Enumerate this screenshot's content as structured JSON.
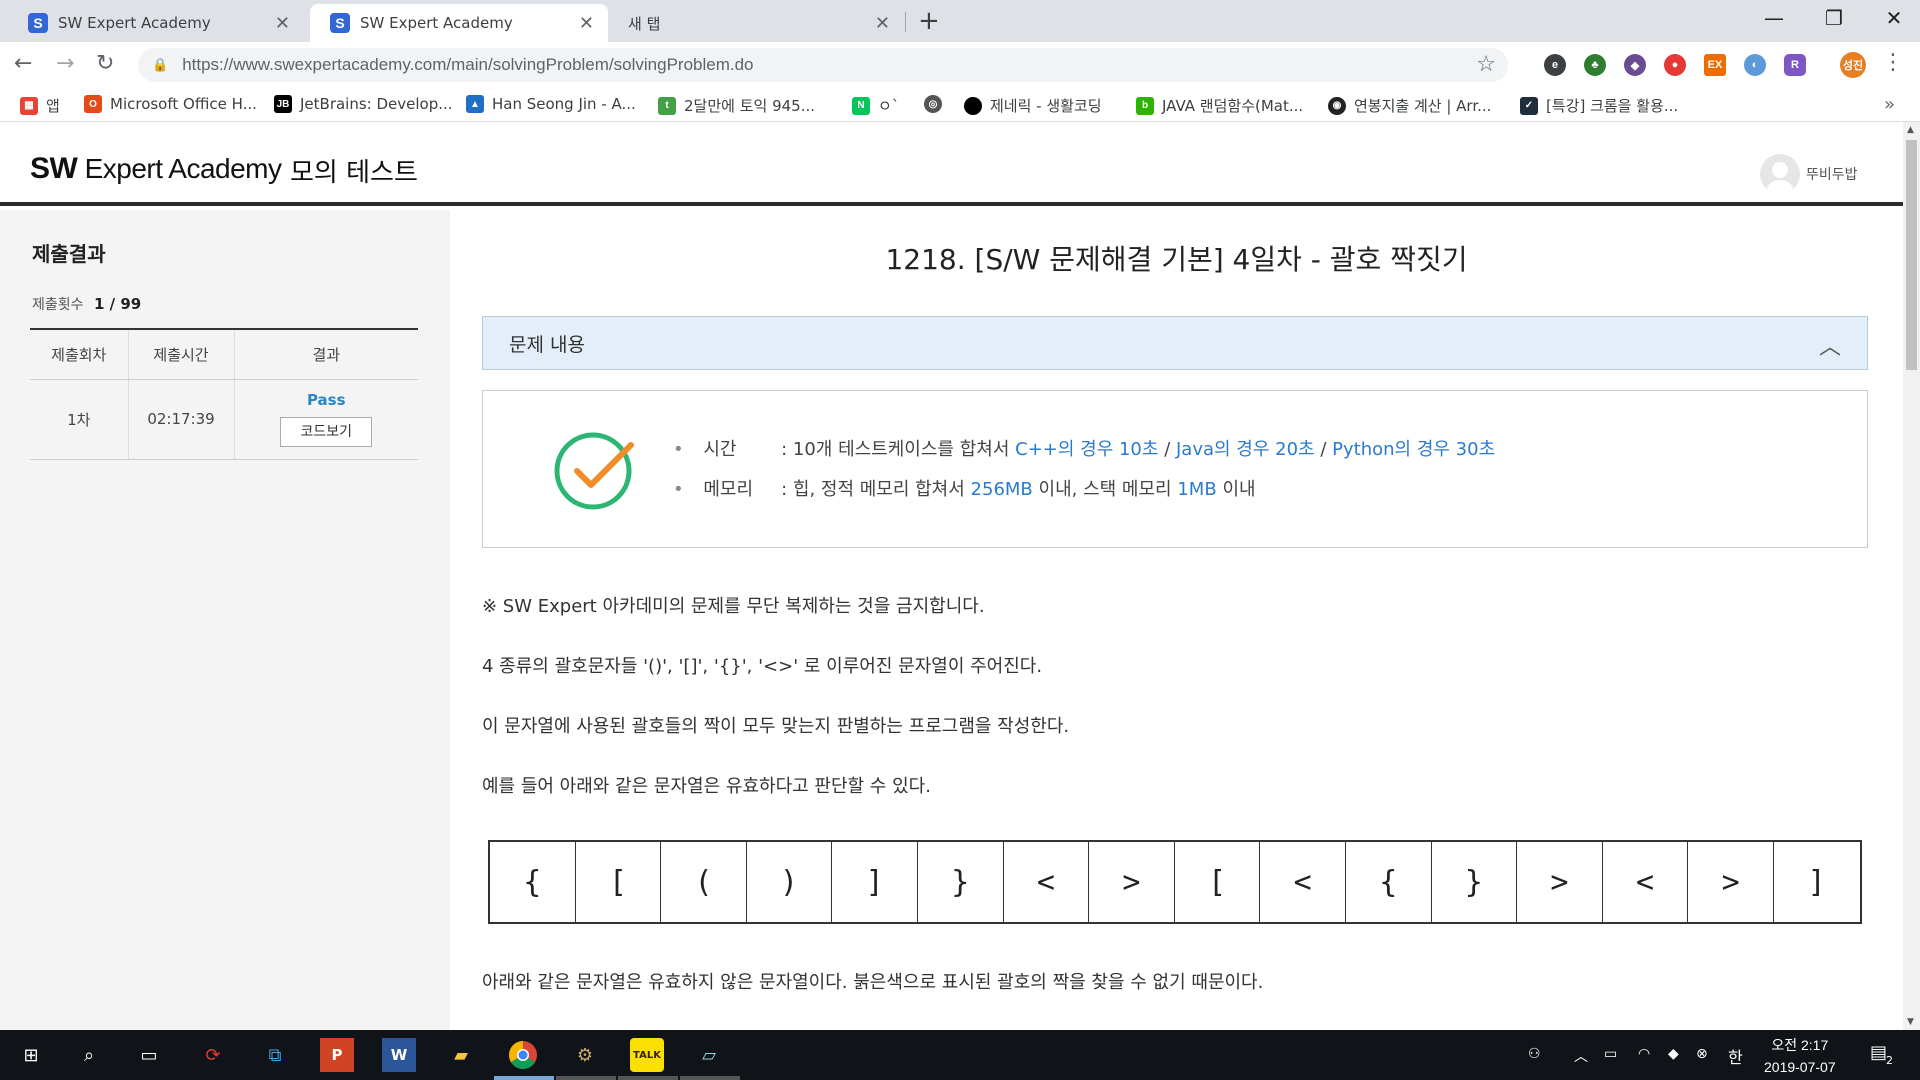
{
  "browser": {
    "tabs": [
      {
        "title": "SW Expert Academy",
        "favicon": "S",
        "active": false
      },
      {
        "title": "SW Expert Academy",
        "favicon": "S",
        "active": true
      },
      {
        "title": "새 탭",
        "favicon": "",
        "active": false
      }
    ],
    "url": "https://www.swexpertacademy.com/main/solvingProblem/solvingProblem.do",
    "profile_badge": "성진",
    "bookmarks": [
      {
        "label": "앱",
        "color": "#e94235"
      },
      {
        "label": "Microsoft Office H...",
        "color": "#e64a19"
      },
      {
        "label": "JetBrains: Develop...",
        "color": "#000000"
      },
      {
        "label": "Han Seong Jin - A...",
        "color": "#1e6fc5"
      },
      {
        "label": "2달만에 토익 945...",
        "color": "#43a047"
      },
      {
        "label": "ㅇ`",
        "color": "#03c75a"
      },
      {
        "label": "",
        "color": "#555555"
      },
      {
        "label": "제네릭 - 생활코딩",
        "color": "#000000"
      },
      {
        "label": "JAVA 랜덤함수(Mat...",
        "color": "#2db400"
      },
      {
        "label": "연봉지출 계산 | Arr...",
        "color": "#222222"
      },
      {
        "label": "[특강] 크롬을 활용...",
        "color": "#1f2d3d"
      }
    ]
  },
  "site": {
    "logo_bold": "SW",
    "logo_rest": " Expert Academy",
    "subtitle": "모의 테스트",
    "username": "뚜비두밥"
  },
  "submission": {
    "title": "제출결과",
    "count_label": "제출횟수",
    "count_value": "1 / 99",
    "headers": [
      "제출회차",
      "제출시간",
      "결과"
    ],
    "rows": [
      {
        "round": "1차",
        "time": "02:17:39",
        "result": "Pass",
        "button": "코드보기"
      }
    ]
  },
  "problem": {
    "title": "1218. [S/W 문제해결 기본] 4일차 - 괄호 짝짓기",
    "section_label": "문제 내용",
    "time_label": "시간",
    "time_prefix": ": 10개 테스트케이스를 합쳐서",
    "time_cpp": "C++의 경우 10초",
    "time_java": "Java의 경우 20초",
    "time_python": "Python의 경우 30초",
    "sep": "/",
    "mem_label": "메모리",
    "mem_prefix": ": 힙, 정적 메모리 합쳐서",
    "mem_heap": "256MB",
    "mem_mid": "이내, 스택 메모리",
    "mem_stack": "1MB",
    "mem_suffix": "이내",
    "notice": "※ SW Expert 아카데미의 문제를 무단 복제하는 것을 금지합니다.",
    "para1": "4 종류의 괄호문자들 '()', '[]', '{}', '<>' 로 이루어진 문자열이 주어진다.",
    "para2": "이 문자열에 사용된 괄호들의 짝이 모두 맞는지 판별하는 프로그램을 작성한다.",
    "para3": "예를 들어 아래와 같은 문자열은 유효하다고 판단할 수 있다.",
    "brackets": [
      "{",
      "[",
      "(",
      ")",
      "]",
      "}",
      "<",
      ">",
      "[",
      "<",
      "{",
      "}",
      ">",
      "<",
      ">",
      "]"
    ],
    "para4": "아래와 같은 문자열은 유효하지 않은 문자열이다. 붉은색으로 표시된 괄호의 짝을 찾을 수 없기 때문이다."
  },
  "taskbar": {
    "time": "오전 2:17",
    "date": "2019-07-07",
    "ime": "한",
    "notif_count": "2"
  }
}
